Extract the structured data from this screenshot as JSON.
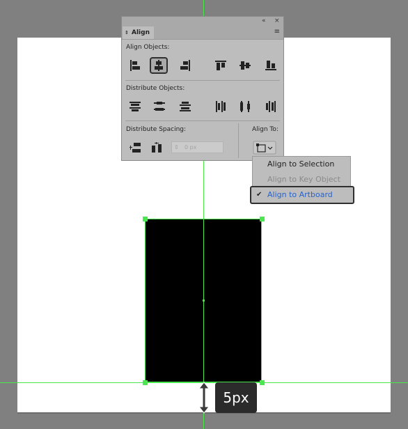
{
  "panel": {
    "tab_title": "Align",
    "collapse_label": "«",
    "close_label": "×",
    "tab_arrows": "⇕",
    "menu_icon": "≡",
    "sections": {
      "align_objects": "Align Objects:",
      "distribute_objects": "Distribute Objects:",
      "distribute_spacing": "Distribute Spacing:",
      "align_to": "Align To:"
    },
    "spacing_value": "0 px",
    "spacing_spin": "⇕"
  },
  "align_to_menu": {
    "items": [
      {
        "label": "Align to Selection",
        "state": "normal"
      },
      {
        "label": "Align to Key Object",
        "state": "disabled"
      },
      {
        "label": "Align to Artboard",
        "state": "selected"
      }
    ],
    "check_mark": "✔"
  },
  "measurement": {
    "label": "5px"
  },
  "colors": {
    "guide": "#49e84e",
    "canvas": "#808080",
    "artboard": "#ffffff",
    "panel_bg": "#bdbdbd",
    "selected_text": "#2a62c8",
    "disabled_text": "#8a8a8a"
  }
}
